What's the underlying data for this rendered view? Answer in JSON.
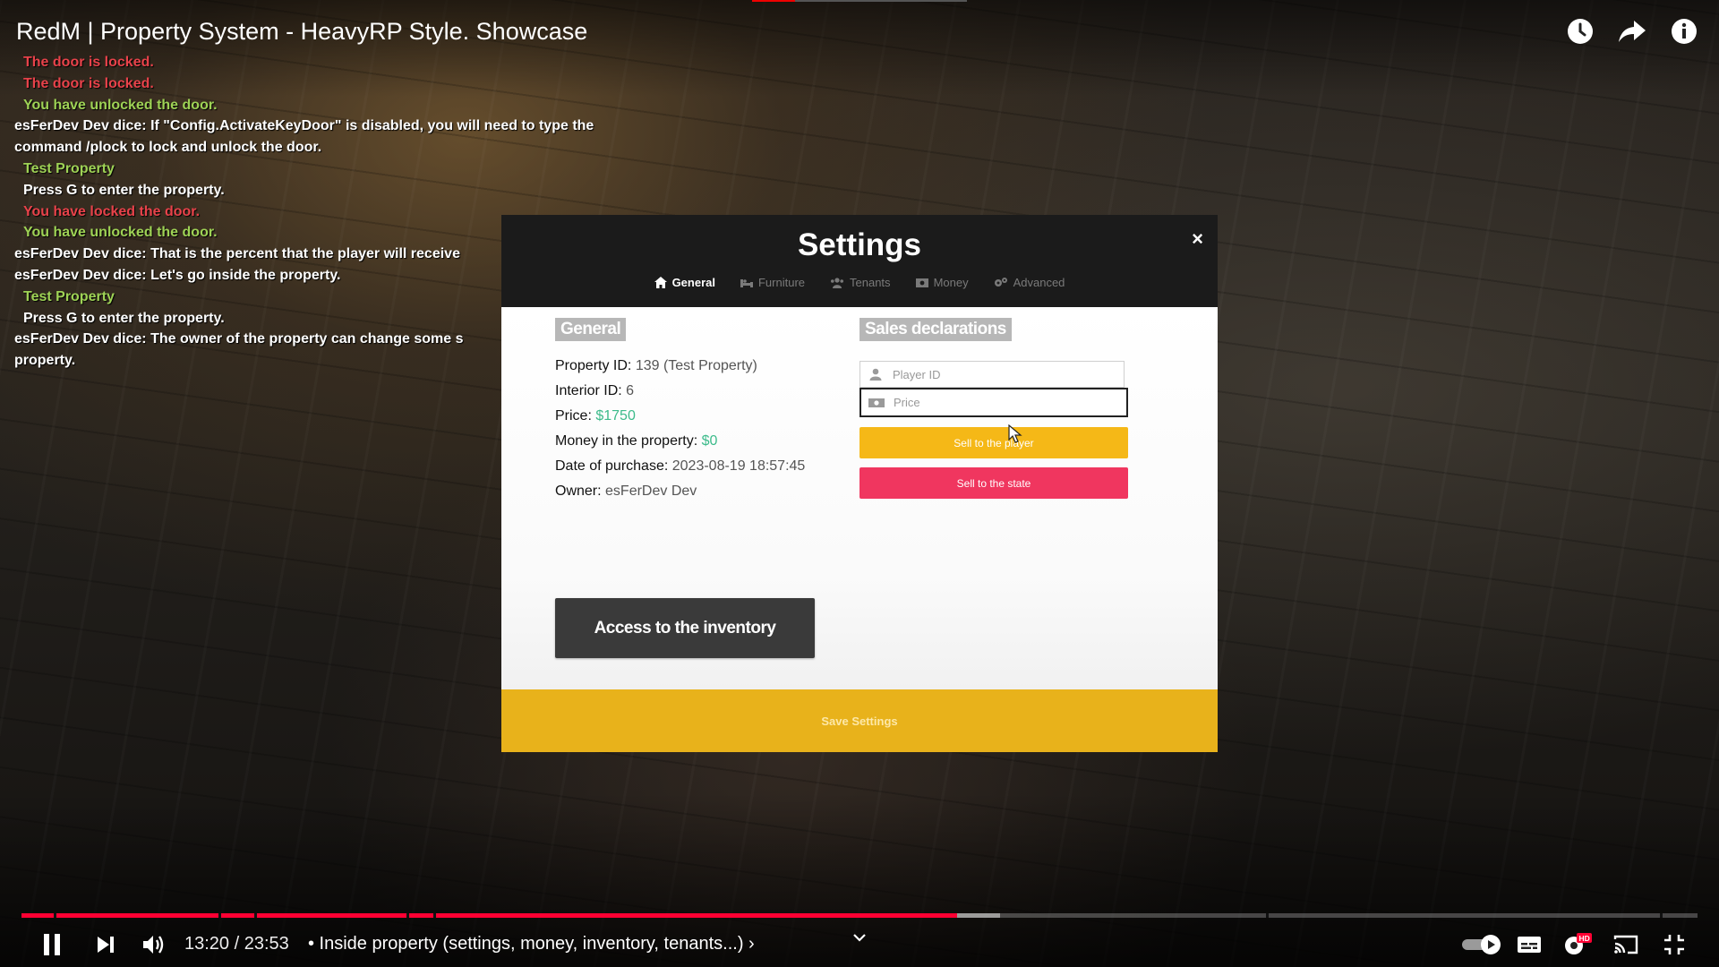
{
  "video": {
    "title": "RedM | Property System - HeavyRP Style. Showcase",
    "current_time": "13:20",
    "duration": "23:53",
    "time_display": "13:20 / 23:53",
    "chapter": "• Inside property (settings, money, inventory, tenants...) ›",
    "progress_percent": 55.8,
    "buffered_percent": 58.4,
    "top_icons": [
      "clock-icon",
      "share-icon",
      "info-icon"
    ],
    "controls": [
      "pause-icon",
      "next-icon",
      "volume-icon",
      "chevron-down-icon",
      "autoplay-toggle",
      "subtitles-icon",
      "settings-hd-icon",
      "cast-icon",
      "exit-fullscreen-icon"
    ]
  },
  "chat": [
    {
      "text": "The door is locked.",
      "color": "red",
      "indent": true
    },
    {
      "text": "The door is locked.",
      "color": "red",
      "indent": true
    },
    {
      "text": "You have unlocked the door.",
      "color": "green",
      "indent": true
    },
    {
      "text": "esFerDev Dev dice: If \"Config.ActivateKeyDoor\" is disabled, you will need to type the",
      "color": "white",
      "indent": false
    },
    {
      "text": "command /plock to lock and unlock the door.",
      "color": "white",
      "indent": false
    },
    {
      "text": "Test Property",
      "color": "green",
      "indent": true
    },
    {
      "text": "Press G to enter the property.",
      "color": "white",
      "indent": true
    },
    {
      "text": "You have locked the door.",
      "color": "red",
      "indent": true
    },
    {
      "text": "You have unlocked the door.",
      "color": "green",
      "indent": true
    },
    {
      "text": "esFerDev Dev dice: That is the percent that the player will receive",
      "color": "white",
      "indent": false
    },
    {
      "text": "esFerDev Dev dice: Let's go inside the property.",
      "color": "white",
      "indent": false
    },
    {
      "text": "Test Property",
      "color": "green",
      "indent": true
    },
    {
      "text": "Press G to enter the property.",
      "color": "white",
      "indent": true
    },
    {
      "text": "esFerDev Dev dice: The owner of the property can change some s",
      "color": "white",
      "indent": false
    },
    {
      "text": "property.",
      "color": "white",
      "indent": false
    }
  ],
  "settings": {
    "title": "Settings",
    "close_label": "×",
    "tabs": [
      {
        "label": "General",
        "icon": "home-icon",
        "active": true
      },
      {
        "label": "Furniture",
        "icon": "furniture-icon",
        "active": false
      },
      {
        "label": "Tenants",
        "icon": "users-icon",
        "active": false
      },
      {
        "label": "Money",
        "icon": "money-icon",
        "active": false
      },
      {
        "label": "Advanced",
        "icon": "gears-icon",
        "active": false
      }
    ],
    "general": {
      "heading": "General",
      "property_id_label": "Property ID:",
      "property_id_value": "139 (Test Property)",
      "interior_id_label": "Interior ID:",
      "interior_id_value": "6",
      "price_label": "Price:",
      "price_value": "$1750",
      "money_label": "Money in the property:",
      "money_value": "$0",
      "date_label": "Date of purchase:",
      "date_value": "2023-08-19 18:57:45",
      "owner_label": "Owner:",
      "owner_value": "esFerDev Dev",
      "inventory_button": "Access to the inventory"
    },
    "sales": {
      "heading": "Sales declarations",
      "player_id_placeholder": "Player ID",
      "player_id_value": "",
      "price_placeholder": "Price",
      "price_value": "",
      "sell_player_button": "Sell to the player",
      "sell_state_button": "Sell to the state"
    },
    "save_button": "Save Settings"
  },
  "colors": {
    "accent_yellow": "#f5b817",
    "danger_pink": "#f0365f",
    "money_green": "#3dbb8b",
    "chat_red": "#e8424a",
    "chat_green": "#9ed255",
    "youtube_red": "#ff0033"
  }
}
